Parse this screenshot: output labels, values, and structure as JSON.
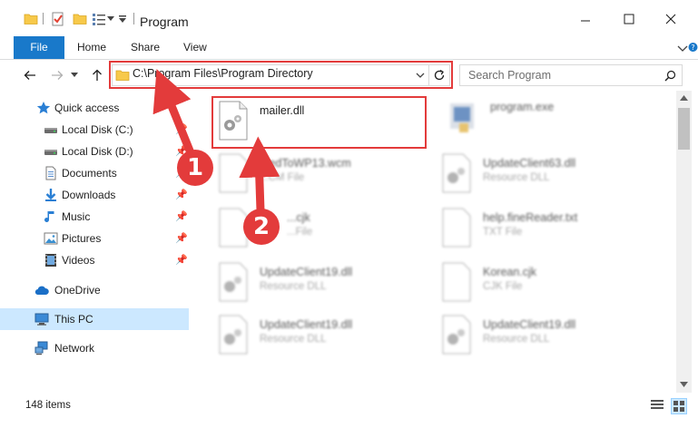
{
  "window": {
    "title": "Program",
    "controls": [
      "minimize-icon",
      "maximize-icon",
      "close-icon"
    ]
  },
  "ribbon": {
    "tabs": [
      "File",
      "Home",
      "Share",
      "View"
    ]
  },
  "address": {
    "path": "C:\\Program Files\\Program Directory",
    "search_placeholder": "Search Program"
  },
  "nav": {
    "items": [
      {
        "label": "Quick access",
        "icon": "star-icon",
        "pinned": false
      },
      {
        "label": "Local Disk (C:)",
        "icon": "drive-icon",
        "pinned": true
      },
      {
        "label": "Local Disk (D:)",
        "icon": "drive-icon",
        "pinned": true
      },
      {
        "label": "Documents",
        "icon": "documents-icon",
        "pinned": true
      },
      {
        "label": "Downloads",
        "icon": "download-icon",
        "pinned": true
      },
      {
        "label": "Music",
        "icon": "music-icon",
        "pinned": true
      },
      {
        "label": "Pictures",
        "icon": "pictures-icon",
        "pinned": true
      },
      {
        "label": "Videos",
        "icon": "videos-icon",
        "pinned": true
      },
      {
        "label": "OneDrive",
        "icon": "cloud-icon",
        "pinned": false
      },
      {
        "label": "This PC",
        "icon": "computer-icon",
        "pinned": false,
        "selected": true
      },
      {
        "label": "Network",
        "icon": "network-icon",
        "pinned": false
      }
    ],
    "pin_glyph": "📌"
  },
  "files": [
    {
      "name": "mailer.dll",
      "type": "",
      "icon": "dll-gear-icon"
    },
    {
      "name": "program.exe",
      "type": "",
      "icon": "exe-icon"
    },
    {
      "name": "...edToWP13.wcm",
      "type": "...CM File",
      "icon": "file-icon"
    },
    {
      "name": "UpdateClient63.dll",
      "type": "Resource DLL",
      "icon": "dll-gear-icon"
    },
    {
      "name": "...cjk",
      "type": "...File",
      "icon": "file-icon"
    },
    {
      "name": "help.fineReader.txt",
      "type": "TXT File",
      "icon": "file-icon"
    },
    {
      "name": "UpdateClient19.dll",
      "type": "Resource DLL",
      "icon": "dll-gear-icon"
    },
    {
      "name": "Korean.cjk",
      "type": "CJK File",
      "icon": "file-icon"
    },
    {
      "name": "UpdateClient19.dll",
      "type": "Resource DLL",
      "icon": "dll-gear-icon"
    },
    {
      "name": "UpdateClient19.dll",
      "type": "Resource DLL",
      "icon": "dll-gear-icon"
    }
  ],
  "status": {
    "count": "148 items"
  },
  "annotations": {
    "callout1": "1",
    "callout2": "2",
    "highlight_color": "#e33b3b"
  },
  "colors": {
    "accent": "#1979ca",
    "selection": "#cce8ff"
  }
}
